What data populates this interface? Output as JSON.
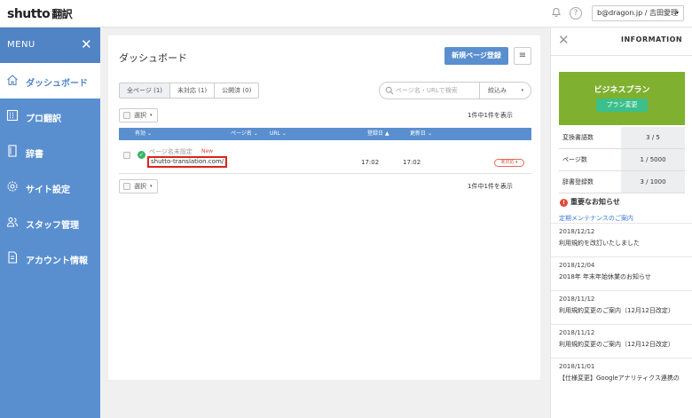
{
  "app": {
    "logo": "shutto",
    "logo_sub": "翻訳"
  },
  "header": {
    "user": "b@dragon.jp / 吉田愛理",
    "caret": "▾",
    "bell_icon": "bell-icon",
    "help_icon": "help-icon",
    "help_glyph": "?"
  },
  "sidebar": {
    "menu_label": "MENU",
    "close_glyph": "✕",
    "items": [
      {
        "label": "ダッシュボード",
        "icon": "home-icon",
        "active": true
      },
      {
        "label": "プロ翻訳",
        "icon": "grid-icon",
        "active": false
      },
      {
        "label": "辞書",
        "icon": "book-icon",
        "active": false
      },
      {
        "label": "サイト設定",
        "icon": "gear-icon",
        "active": false
      },
      {
        "label": "スタッフ管理",
        "icon": "users-icon",
        "active": false
      },
      {
        "label": "アカウント情報",
        "icon": "document-icon",
        "active": false
      }
    ]
  },
  "main": {
    "title": "ダッシュボード",
    "new_page_button": "新規ページ登録",
    "menu_glyph": "≡",
    "tabs": [
      {
        "label": "全ページ (1)",
        "active": true
      },
      {
        "label": "未対応 (1)",
        "active": false
      },
      {
        "label": "公開済 (0)",
        "active": false
      }
    ],
    "search_placeholder": "ページ名・URLで検索",
    "filter_label": "絞込み",
    "select_label": "選択",
    "count_text": "1件中1件を表示",
    "columns": {
      "valid": "有効",
      "page_name": "ページ名",
      "url": "URL",
      "registered": "登録日",
      "updated": "更新日"
    },
    "sort_glyph": "⌄",
    "sort_active_glyph": "▲",
    "rows": [
      {
        "name": "ページ名未設定",
        "new_badge": "New",
        "url": "shutto-translation.com/",
        "registered": "17:02",
        "updated": "17:02",
        "status": "未対応"
      }
    ]
  },
  "info": {
    "title": "INFORMATION",
    "close_glyph": "✕",
    "plan_name": "ビジネスプラン",
    "plan_button": "プラン変更",
    "stats": [
      {
        "label": "変換書語数",
        "value": "3 / 5"
      },
      {
        "label": "ページ数",
        "value": "1 / 5000"
      },
      {
        "label": "辞書登録数",
        "value": "3 / 1000"
      }
    ],
    "notice_heading": "重要なお知らせ",
    "notice_alert_glyph": "!",
    "notice_link": "定期メンテナンスのご案内",
    "news": [
      {
        "date": "2018/12/12",
        "text": "利用規約を改訂いたしました"
      },
      {
        "date": "2018/12/04",
        "text": "2018年 年末年始休業のお知らせ"
      },
      {
        "date": "2018/11/12",
        "text": "利用規約変更のご案内（12月12日改定）"
      },
      {
        "date": "2018/11/12",
        "text": "利用規約変更のご案内（12月12日改定）"
      },
      {
        "date": "2018/11/01",
        "text": "【仕様変更】Googleアナリティクス連携の"
      }
    ]
  },
  "colors": {
    "sidebar": "#5a8fcf",
    "plan": "#7fb030",
    "plan_button": "#3cbf8a",
    "alert": "#e04a3a"
  }
}
